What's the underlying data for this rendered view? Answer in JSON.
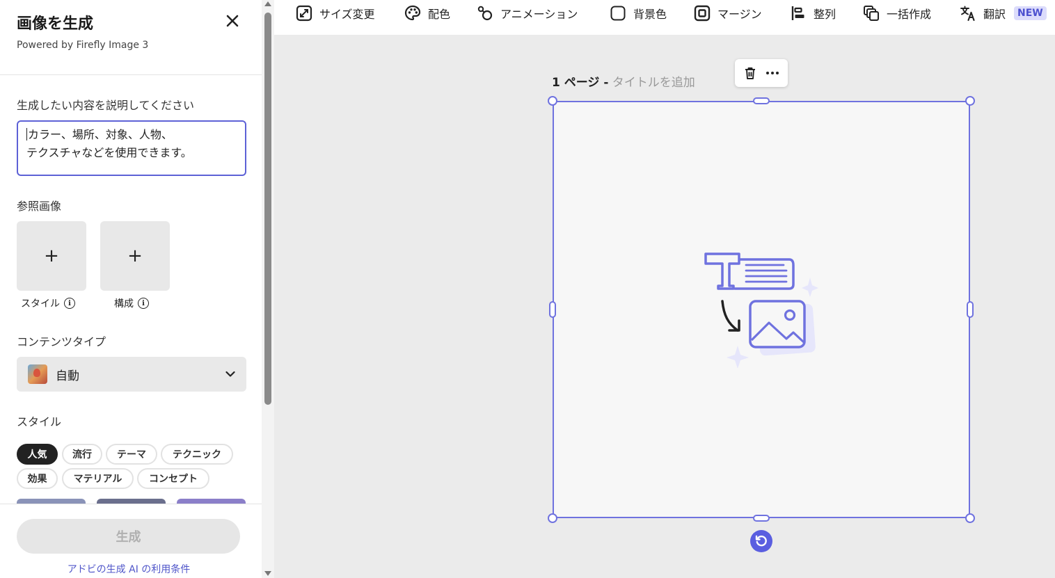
{
  "panel": {
    "title": "画像を生成",
    "subtitle": "Powered by Firefly Image 3",
    "prompt_label": "生成したい内容を説明してください",
    "prompt_placeholder_line1": "カラー、場所、対象、人物、",
    "prompt_placeholder_line2": "テクスチャなどを使用できます。",
    "reference_label": "参照画像",
    "reference_tiles": [
      {
        "plus": "+",
        "caption": "スタイル",
        "info": "i"
      },
      {
        "plus": "+",
        "caption": "構成",
        "info": "i"
      }
    ],
    "content_type_label": "コンテンツタイプ",
    "content_type_value": "自動",
    "style_label": "スタイル",
    "style_chips": [
      "人気",
      "流行",
      "テーマ",
      "テクニック",
      "効果",
      "マテリアル",
      "コンセプト"
    ],
    "active_chip": "人気",
    "generate_button": "生成",
    "terms_link": "アドビの生成 AI の利用条件"
  },
  "toolbar": {
    "items": [
      {
        "label": "サイズ変更",
        "icon": "resize-icon"
      },
      {
        "label": "配色",
        "icon": "palette-icon"
      },
      {
        "label": "アニメーション",
        "icon": "animation-icon"
      },
      {
        "label": "背景色",
        "icon": "background-color-icon"
      },
      {
        "label": "マージン",
        "icon": "margin-icon"
      },
      {
        "label": "整列",
        "icon": "align-icon"
      },
      {
        "label": "一括作成",
        "icon": "bulk-create-icon"
      },
      {
        "label": "翻訳",
        "icon": "translate-icon"
      }
    ],
    "new_badge": "NEW"
  },
  "canvas": {
    "page_number": "1 ページ -",
    "page_title_placeholder": "タイトルを追加",
    "accent_color": "#6f72df"
  },
  "colors": {
    "accent": "#5d61d6",
    "chip_active": "#222222",
    "link": "#4f55c9"
  }
}
